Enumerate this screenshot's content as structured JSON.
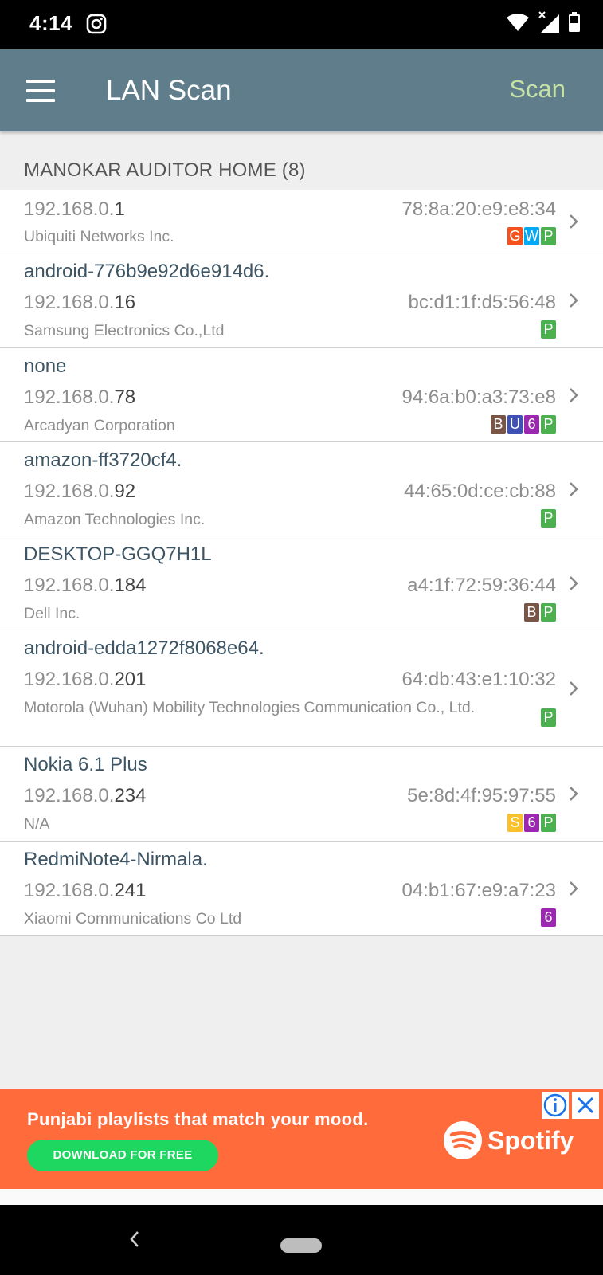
{
  "status_bar": {
    "time": "4:14"
  },
  "app_bar": {
    "title": "LAN Scan",
    "scan_label": "Scan"
  },
  "network": {
    "header": "MANOKAR AUDITOR HOME (8)"
  },
  "badge_colors": {
    "G": "#f4511e",
    "W": "#03a9f4",
    "P": "#4caf50",
    "B": "#795548",
    "U": "#3f51b5",
    "6": "#9c27b0",
    "S": "#fbc02d"
  },
  "devices": [
    {
      "hostname": "",
      "ip_prefix": "192.168.0.",
      "ip_suffix": "1",
      "mac": "78:8a:20:e9:e8:34",
      "vendor": "Ubiquiti Networks Inc.",
      "badges": [
        "G",
        "W",
        "P"
      ]
    },
    {
      "hostname": "android-776b9e92d6e914d6.",
      "ip_prefix": "192.168.0.",
      "ip_suffix": "16",
      "mac": "bc:d1:1f:d5:56:48",
      "vendor": "Samsung Electronics Co.,Ltd",
      "badges": [
        "P"
      ]
    },
    {
      "hostname": "none",
      "ip_prefix": "192.168.0.",
      "ip_suffix": "78",
      "mac": "94:6a:b0:a3:73:e8",
      "vendor": "Arcadyan Corporation",
      "badges": [
        "B",
        "U",
        "6",
        "P"
      ]
    },
    {
      "hostname": "amazon-ff3720cf4.",
      "ip_prefix": "192.168.0.",
      "ip_suffix": "92",
      "mac": "44:65:0d:ce:cb:88",
      "vendor": "Amazon Technologies Inc.",
      "badges": [
        "P"
      ]
    },
    {
      "hostname": "DESKTOP-GGQ7H1L",
      "ip_prefix": "192.168.0.",
      "ip_suffix": "184",
      "mac": "a4:1f:72:59:36:44",
      "vendor": "Dell Inc.",
      "badges": [
        "B",
        "P"
      ]
    },
    {
      "hostname": "android-edda1272f8068e64.",
      "ip_prefix": "192.168.0.",
      "ip_suffix": "201",
      "mac": "64:db:43:e1:10:32",
      "vendor": "Motorola (Wuhan) Mobility Technologies Communication Co., Ltd.",
      "badges": [
        "P"
      ]
    },
    {
      "hostname": "Nokia 6.1 Plus",
      "ip_prefix": "192.168.0.",
      "ip_suffix": "234",
      "mac": "5e:8d:4f:95:97:55",
      "vendor": "N/A",
      "badges": [
        "S",
        "6",
        "P"
      ]
    },
    {
      "hostname": "RedmiNote4-Nirmala.",
      "ip_prefix": "192.168.0.",
      "ip_suffix": "241",
      "mac": "04:b1:67:e9:a7:23",
      "vendor": "Xiaomi Communications Co Ltd",
      "badges": [
        "6"
      ]
    }
  ],
  "ad": {
    "headline": "Punjabi playlists that match your mood.",
    "cta": "DOWNLOAD FOR FREE",
    "brand": "Spotify"
  }
}
